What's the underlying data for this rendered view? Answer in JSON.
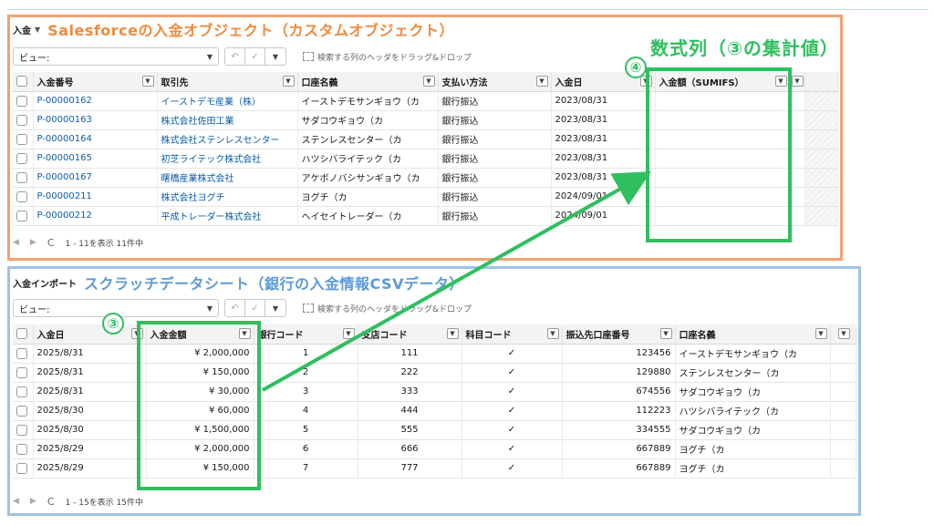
{
  "colors": {
    "orange": "#f08a3c",
    "blue": "#5a9bd8",
    "green": "#2fbf5f",
    "link": "#0b5cab"
  },
  "top": {
    "tab_label": "入金",
    "overlay_title": "Salesforceの入金オブジェクト（カスタムオブジェクト）",
    "view_label": "ビュー:",
    "group_hint": "検索する列のヘッダをドラッグ&ドロップ",
    "columns": [
      "入金番号",
      "取引先",
      "口座名義",
      "支払い方法",
      "入金日",
      "入金額（SUMIFS）"
    ],
    "rows": [
      [
        "P-00000162",
        "イーストデモ産業（株）",
        "イーストデモサンギョウ（カ",
        "銀行振込",
        "2023/08/31"
      ],
      [
        "P-00000163",
        "株式会社佐田工業",
        "サダコウギョウ（カ",
        "銀行振込",
        "2023/08/31"
      ],
      [
        "P-00000164",
        "株式会社ステンレスセンター",
        "ステンレスセンター（カ",
        "銀行振込",
        "2023/08/31"
      ],
      [
        "P-00000165",
        "初芝ライテック株式会社",
        "ハツシバライテック（カ",
        "銀行振込",
        "2023/08/31"
      ],
      [
        "P-00000167",
        "曙橋産業株式会社",
        "アケボノバシサンギョウ（カ",
        "銀行振込",
        "2023/08/31"
      ],
      [
        "P-00000211",
        "株式会社ヨグチ",
        "ヨグチ（カ",
        "銀行振込",
        "2024/09/01"
      ],
      [
        "P-00000212",
        "平成トレーダー株式会社",
        "ヘイセイトレーダー（カ",
        "銀行振込",
        "2024/09/01"
      ]
    ],
    "footer_text": "1 - 11を表示 11件中"
  },
  "bottom": {
    "tab_label": "入金インポート",
    "overlay_title": "スクラッチデータシート（銀行の入金情報CSVデータ）",
    "view_label": "ビュー:",
    "group_hint": "検索する列のヘッダをドラッグ&ドロップ",
    "columns": [
      "入金日",
      "入金金額",
      "銀行コード",
      "支店コード",
      "科目コード",
      "振込先口座番号",
      "口座名義"
    ],
    "rows": [
      [
        "2025/8/31",
        "¥ 2,000,000",
        "1",
        "111",
        "✓",
        "123456",
        "イーストデモサンギョウ（カ"
      ],
      [
        "2025/8/31",
        "¥ 150,000",
        "2",
        "222",
        "✓",
        "129880",
        "ステンレスセンター（カ"
      ],
      [
        "2025/8/31",
        "¥ 30,000",
        "3",
        "333",
        "✓",
        "674556",
        "サダコウギョウ（カ"
      ],
      [
        "2025/8/30",
        "¥ 60,000",
        "4",
        "444",
        "✓",
        "112223",
        "ハツシバライテック（カ"
      ],
      [
        "2025/8/30",
        "¥ 1,500,000",
        "5",
        "555",
        "✓",
        "334555",
        "サダコウギョウ（カ"
      ],
      [
        "2025/8/29",
        "¥ 2,000,000",
        "6",
        "666",
        "✓",
        "667889",
        "ヨグチ（カ"
      ],
      [
        "2025/8/29",
        "¥ 150,000",
        "7",
        "777",
        "✓",
        "667889",
        "ヨグチ（カ"
      ]
    ],
    "footer_text": "1 - 15を表示 15件中"
  },
  "annotations": {
    "marker_3": "③",
    "marker_4": "④",
    "formula_title": "数式列（③の集計値）"
  },
  "icons": {
    "undo": "↶",
    "check": "✓",
    "caret": "▼",
    "refresh": "C",
    "prev": "◀",
    "next": "▶"
  }
}
